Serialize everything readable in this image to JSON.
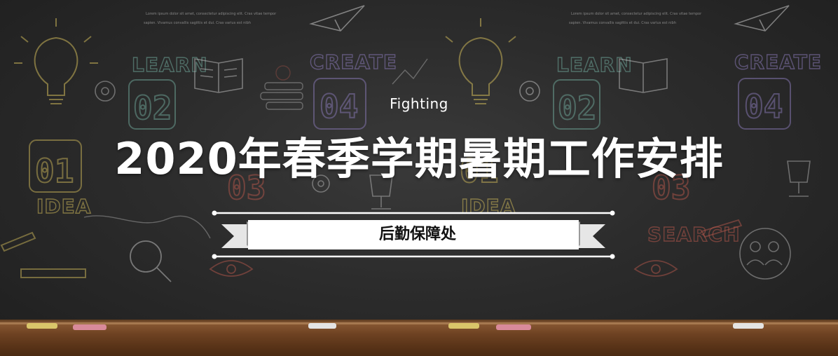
{
  "header": {
    "subtitle": "Fighting",
    "title": "2020年春季学期暑期工作安排"
  },
  "banner": {
    "label": "后勤保障处"
  },
  "background": {
    "learn_label": "LEARN",
    "create_label": "CREATE",
    "idea_label": "IDEA",
    "search_label": "SEARCH",
    "num_01": "01",
    "num_02": "02",
    "num_03": "03",
    "num_04": "04",
    "lorem_line_1": "Lorem ipsum dolor sit amet, consectetur adipiscing elit. Cras vitae tempor",
    "lorem_line_2": "sapien. Vivamus convallis sagittis et dui. Cras varius est nibh",
    "colors": {
      "board": "#2c2c2c",
      "chalk_yellow": "#c9b458",
      "chalk_teal": "#6fa79a",
      "chalk_purple": "#8a7ab8",
      "chalk_red": "#b5574b",
      "chalk_white": "#d8d8d8",
      "ledge_wood": "#6e4222"
    }
  },
  "icons": [
    "lightbulb-icon",
    "book-icon",
    "gear-icon",
    "paper-plane-icon",
    "magnifier-icon",
    "trophy-icon",
    "eye-icon",
    "pencil-icon",
    "people-icon"
  ]
}
